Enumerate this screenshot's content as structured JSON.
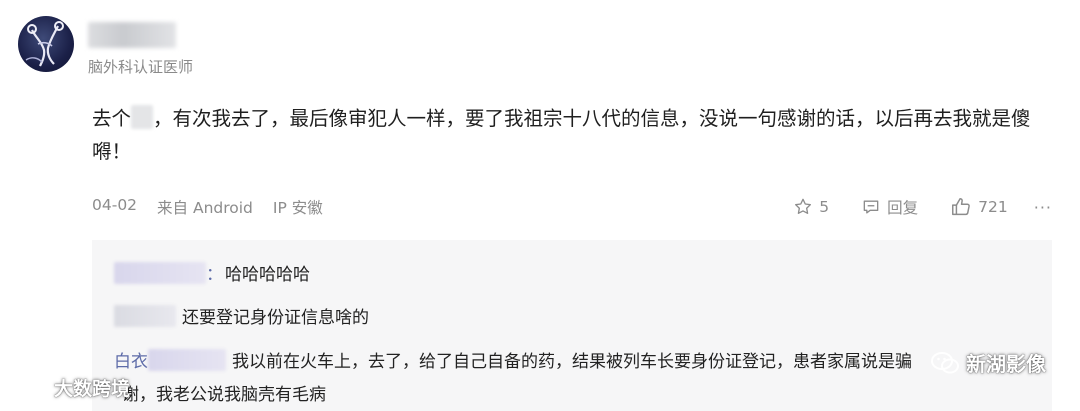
{
  "author": {
    "role": "脑外科认证医师"
  },
  "comment": {
    "text_before_blur": "去个",
    "text_after_blur": "，有次我去了，最后像审犯人一样，要了我祖宗十八代的信息，没说一句感谢的话，以后再去我就是傻嘚！"
  },
  "meta": {
    "date": "04-02",
    "source": "来自 Android",
    "ip": "IP 安徽",
    "favorite_count": "5",
    "reply_label": "回复",
    "like_count": "721",
    "more_label": "···"
  },
  "replies": [
    {
      "colon": "：",
      "text": "哈哈哈哈哈"
    },
    {
      "text": "还要登记身份证信息啥的"
    },
    {
      "name_prefix": "白衣",
      "text": "我以前在火车上，去了，给了自己自备的药，结果被列车长要身份证登记，患者家属说是骗 "
    },
    {
      "text": "谢，我老公说我脑壳有毛病"
    }
  ],
  "watermarks": {
    "left": "大数跨境",
    "right": "新湖影像"
  },
  "colors": {
    "reply_bg": "#f6f6f7",
    "meta_gray": "#8c8c8c",
    "link_purple": "#5d6ba8"
  }
}
